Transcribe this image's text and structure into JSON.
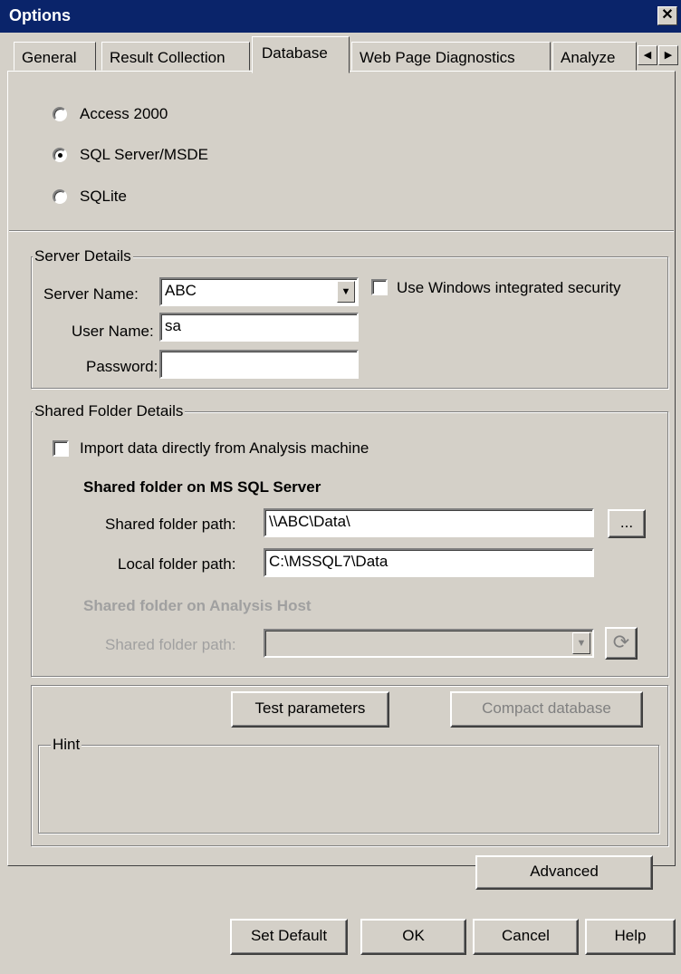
{
  "window": {
    "title": "Options",
    "close_glyph": "✕"
  },
  "tabs": [
    {
      "label": "General"
    },
    {
      "label": "Result Collection"
    },
    {
      "label": "Database"
    },
    {
      "label": "Web Page Diagnostics"
    },
    {
      "label": "Analyze"
    }
  ],
  "tab_scroll": {
    "left": "◀",
    "right": "▶"
  },
  "db_type": {
    "options": [
      "Access 2000",
      "SQL Server/MSDE",
      "SQLite"
    ],
    "selected": "SQL Server/MSDE"
  },
  "server_details": {
    "legend": "Server Details",
    "server_name_label": "Server Name:",
    "server_name_value": "ABC",
    "user_name_label": "User Name:",
    "user_name_value": "sa",
    "password_label": "Password:",
    "password_value": "",
    "windows_security_label": "Use Windows integrated security",
    "windows_security_checked": false
  },
  "shared_folder": {
    "legend": "Shared Folder Details",
    "import_label": "Import data directly from Analysis machine",
    "import_checked": false,
    "sql_heading": "Shared folder on MS SQL Server",
    "shared_path_label": "Shared folder path:",
    "shared_path_value": "\\\\ABC\\Data\\",
    "browse_label": "...",
    "local_path_label": "Local folder path:",
    "local_path_value": "C:\\MSSQL7\\Data",
    "analysis_heading": "Shared folder on Analysis Host",
    "analysis_path_label": "Shared folder path:",
    "analysis_path_value": ""
  },
  "actions": {
    "test_label": "Test parameters",
    "compact_label": "Compact database",
    "hint_legend": "Hint",
    "hint_text": "",
    "advanced_label": "Advanced"
  },
  "footer": {
    "set_default": "Set Default",
    "ok": "OK",
    "cancel": "Cancel",
    "help": "Help"
  }
}
